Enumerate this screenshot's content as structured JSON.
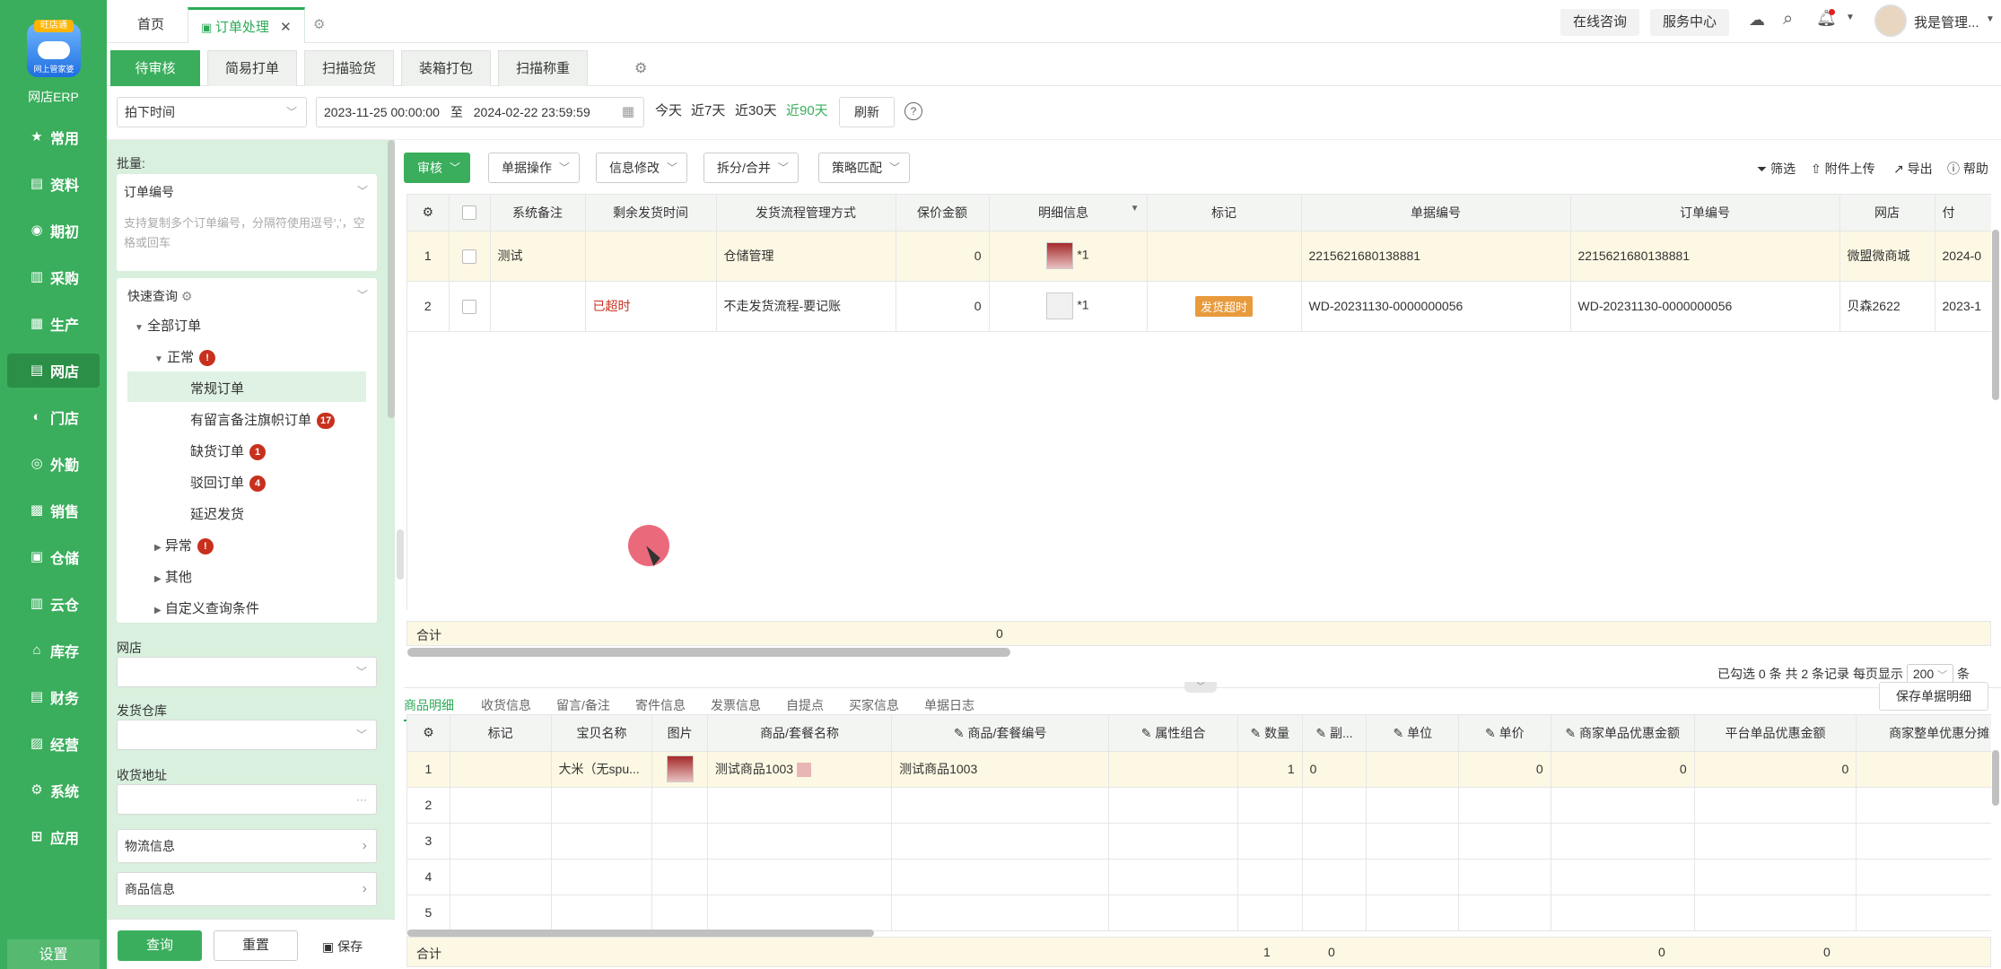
{
  "app": {
    "logo_tag": "旺店通",
    "logo_sub": "网上管家婆",
    "name": "网店ERP"
  },
  "nav": [
    {
      "label": "常用",
      "icon": "star-icon",
      "glyph": "★"
    },
    {
      "label": "资料",
      "icon": "document-icon",
      "glyph": "▤"
    },
    {
      "label": "期初",
      "icon": "clock-icon",
      "glyph": "◉"
    },
    {
      "label": "采购",
      "icon": "purchase-icon",
      "glyph": "▥"
    },
    {
      "label": "生产",
      "icon": "production-icon",
      "glyph": "▦"
    },
    {
      "label": "网店",
      "icon": "store-icon",
      "glyph": "▤",
      "active": true
    },
    {
      "label": "门店",
      "icon": "shop-icon",
      "glyph": "◐"
    },
    {
      "label": "外勤",
      "icon": "field-icon",
      "glyph": "◎"
    },
    {
      "label": "销售",
      "icon": "sales-icon",
      "glyph": "▩"
    },
    {
      "label": "仓储",
      "icon": "warehouse-icon",
      "glyph": "▣"
    },
    {
      "label": "云仓",
      "icon": "cloud-warehouse-icon",
      "glyph": "▥"
    },
    {
      "label": "库存",
      "icon": "inventory-icon",
      "glyph": "⌂"
    },
    {
      "label": "财务",
      "icon": "finance-icon",
      "glyph": "▤"
    },
    {
      "label": "经营",
      "icon": "business-icon",
      "glyph": "▨"
    },
    {
      "label": "系统",
      "icon": "system-gear-icon",
      "glyph": "⚙"
    },
    {
      "label": "应用",
      "icon": "apps-icon",
      "glyph": "⊞"
    }
  ],
  "nav_settings": "设置",
  "page_tabs": {
    "home": "首页",
    "current": "订单处理"
  },
  "topbar": {
    "consult": "在线咨询",
    "service": "服务中心",
    "user": "我是管理..."
  },
  "sub_tabs": [
    "待审核",
    "简易打单",
    "扫描验货",
    "装箱打包",
    "扫描称重"
  ],
  "filter": {
    "time_type": "拍下时间",
    "date_start": "2023-11-25 00:00:00",
    "date_sep": "至",
    "date_end": "2024-02-22 23:59:59",
    "quick": [
      "今天",
      "近7天",
      "近30天",
      "近90天"
    ],
    "refresh": "刷新"
  },
  "left": {
    "batch_label": "批量:",
    "batch_field": "订单编号",
    "batch_placeholder": "支持复制多个订单编号，分隔符使用逗号','，空格或回车",
    "quick_query": "快速查询",
    "tree": {
      "all": "全部订单",
      "normal": "正常",
      "regular": "常规订单",
      "remark_flag": "有留言备注旗帜订单",
      "remark_flag_count": "17",
      "shortage": "缺货订单",
      "shortage_count": "1",
      "rejected": "驳回订单",
      "rejected_count": "4",
      "delayed": "延迟发货",
      "abnormal": "异常",
      "other": "其他",
      "custom": "自定义查询条件"
    },
    "store_label": "网店",
    "warehouse_label": "发货仓库",
    "address_label": "收货地址",
    "address_more": "···",
    "logistics": "物流信息",
    "goods": "商品信息",
    "query_btn": "查询",
    "reset_btn": "重置",
    "save_btn": "保存"
  },
  "toolbar": {
    "audit": "审核",
    "single_op": "单据操作",
    "info_edit": "信息修改",
    "split_merge": "拆分/合并",
    "strategy": "策略匹配",
    "filter": "筛选",
    "attach": "附件上传",
    "export": "导出",
    "help": "帮助"
  },
  "order_table": {
    "headers": [
      "系统备注",
      "剩余发货时间",
      "发货流程管理方式",
      "保价金额",
      "明细信息",
      "标记",
      "单据编号",
      "订单编号",
      "网店",
      "付"
    ],
    "rows": [
      {
        "no": "1",
        "remark": "测试",
        "remain": "",
        "flow": "仓储管理",
        "insured": "0",
        "detail": "*1",
        "mark": "",
        "bill_no": "2215621680138881",
        "order_no": "2215621680138881",
        "store": "微盟微商城",
        "pay": "2024-0"
      },
      {
        "no": "2",
        "remark": "",
        "remain": "已超时",
        "flow": "不走发货流程-要记账",
        "insured": "0",
        "detail": "*1",
        "mark": "发货超时",
        "bill_no": "WD-20231130-0000000056",
        "order_no": "WD-20231130-0000000056",
        "store": "贝森2622",
        "pay": "2023-1"
      }
    ],
    "total_label": "合计",
    "total_insured": "0",
    "pager": {
      "selected": "已勾选 0 条",
      "total": "共 2 条记录",
      "per_page_label": "每页显示",
      "per_page": "200",
      "unit": "条"
    }
  },
  "bottom_tabs": [
    "商品明细",
    "收货信息",
    "留言/备注",
    "寄件信息",
    "发票信息",
    "自提点",
    "买家信息",
    "单据日志"
  ],
  "save_detail": "保存单据明细",
  "item_table": {
    "headers": [
      "标记",
      "宝贝名称",
      "图片",
      "商品/套餐名称",
      "商品/套餐编号",
      "属性组合",
      "数量",
      "副...",
      "单位",
      "单价",
      "商家单品优惠金额",
      "平台单品优惠金额",
      "商家整单优惠分摊"
    ],
    "row": {
      "no": "1",
      "name": "大米（无spu...",
      "product": "测试商品1003",
      "code": "测试商品1003",
      "qty": "1",
      "sub": "0",
      "price": "0",
      "merchant_disc": "0",
      "platform_disc": "0"
    },
    "empty_rows": [
      "2",
      "3",
      "4",
      "5"
    ],
    "total_label": "合计",
    "total_qty": "1",
    "total_sub": "0",
    "total_merchant": "0",
    "total_platform": "0"
  }
}
